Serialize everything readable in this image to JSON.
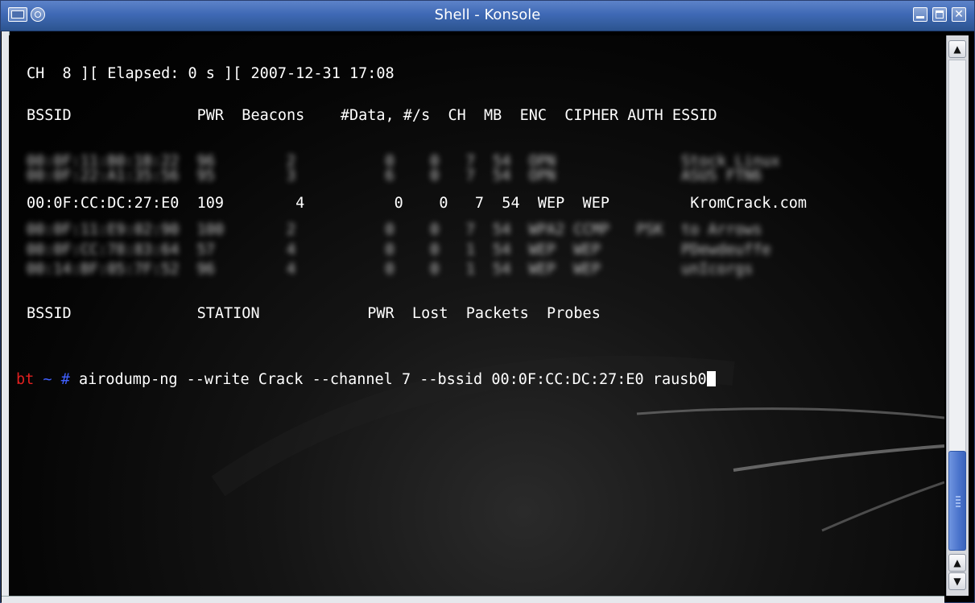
{
  "window": {
    "title": "Shell - Konsole",
    "close_glyph": "✕"
  },
  "terminal": {
    "status_line": "CH  8 ][ Elapsed: 0 s ][ 2007-12-31 17:08",
    "ap_header": "BSSID              PWR  Beacons    #Data, #/s  CH  MB  ENC  CIPHER AUTH ESSID",
    "blurred_rows_top": [
      "00:0F:11:B0:1B:22  96        2          0    0   7  54  OPN              Stock Linux",
      "00:0F:22:A1:35:56  95        3          6    0   7  54  OPN              ASUS FTN6"
    ],
    "target_row": "00:0F:CC:DC:27:E0  109        4          0    0   7  54  WEP  WEP         KromCrack.com",
    "blurred_rows_bottom": [
      "00:0F:11:E9:02:90  100       2          0    0   7  54  WPA2 CCMP   PSK  to Arrows",
      "00:0F:CC:78:83:64  57        4          0    0   1  54  WEP  WEP         PDewdeuffe",
      "00:14:BF:05:7F:52  96        4          0    0   1  54  WEP  WEP         unIcorgs"
    ],
    "station_header": "BSSID              STATION            PWR  Lost  Packets  Probes",
    "prompt_host": "bt",
    "prompt_path": " ~ ",
    "prompt_symbol": "#",
    "command": " airodump-ng --write Crack --channel 7 --bssid 00:0F:CC:DC:27:E0 rausb0"
  },
  "scrollbar": {
    "up_glyph": "▲",
    "down_glyph": "▼"
  },
  "colors": {
    "prompt_host": "#e02020",
    "prompt_symbol": "#4060ff",
    "titlebar": "#3f69b5",
    "scroll_thumb": "#4b74cc"
  },
  "icons": [
    "window-menu-icon",
    "sticky-icon",
    "minimize-icon",
    "maximize-icon",
    "close-icon"
  ]
}
